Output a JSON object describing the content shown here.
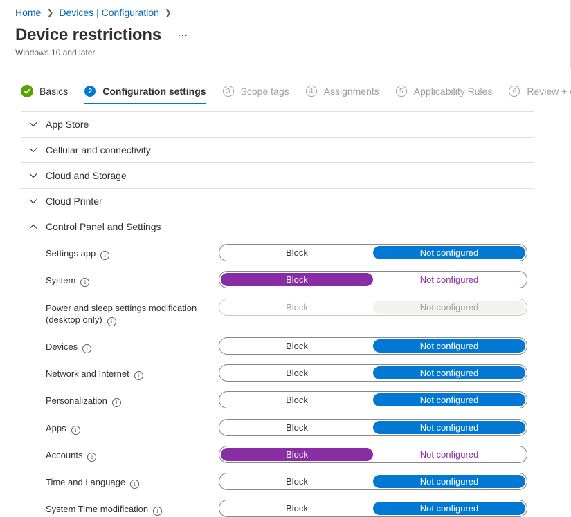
{
  "breadcrumb": {
    "items": [
      "Home",
      "Devices | Configuration"
    ]
  },
  "page": {
    "title": "Device restrictions",
    "more_label": "...",
    "subtitle": "Windows 10 and later"
  },
  "steps": [
    {
      "number": "",
      "label": "Basics",
      "state": "done"
    },
    {
      "number": "2",
      "label": "Configuration settings",
      "state": "active"
    },
    {
      "number": "3",
      "label": "Scope tags",
      "state": "pending"
    },
    {
      "number": "4",
      "label": "Assignments",
      "state": "pending"
    },
    {
      "number": "5",
      "label": "Applicability Rules",
      "state": "pending"
    },
    {
      "number": "6",
      "label": "Review + c",
      "state": "pending"
    }
  ],
  "accordion": [
    {
      "label": "App Store",
      "expanded": false
    },
    {
      "label": "Cellular and connectivity",
      "expanded": false
    },
    {
      "label": "Cloud and Storage",
      "expanded": false
    },
    {
      "label": "Cloud Printer",
      "expanded": false
    },
    {
      "label": "Control Panel and Settings",
      "expanded": true
    }
  ],
  "toggle_options": {
    "block": "Block",
    "not_configured": "Not configured"
  },
  "settings": [
    {
      "label": "Settings app",
      "value": "Not configured",
      "disabled": false
    },
    {
      "label": "System",
      "value": "Block",
      "disabled": false
    },
    {
      "label": "Power and sleep settings modification (desktop only)",
      "value": "Not configured",
      "disabled": true
    },
    {
      "label": "Devices",
      "value": "Not configured",
      "disabled": false
    },
    {
      "label": "Network and Internet",
      "value": "Not configured",
      "disabled": false
    },
    {
      "label": "Personalization",
      "value": "Not configured",
      "disabled": false
    },
    {
      "label": "Apps",
      "value": "Not configured",
      "disabled": false
    },
    {
      "label": "Accounts",
      "value": "Block",
      "disabled": false
    },
    {
      "label": "Time and Language",
      "value": "Not configured",
      "disabled": false
    },
    {
      "label": "System Time modification",
      "value": "Not configured",
      "disabled": false
    }
  ],
  "colors": {
    "accent": "#0078d4",
    "block_selected": "#8a2da5",
    "done": "#57a300",
    "link": "#0067b8"
  },
  "icons": {
    "chevron_collapsed": "chevron-down-icon",
    "chevron_expanded": "chevron-up-icon",
    "info": "info-icon",
    "check": "checkmark-icon"
  }
}
